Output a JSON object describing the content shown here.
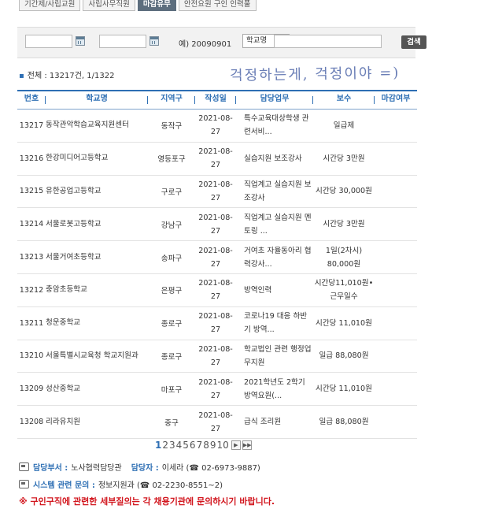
{
  "tabs": [
    "기간제/사립교원",
    "사립사무직원",
    "마감유무",
    "안전요원 구인 인력풀"
  ],
  "search": {
    "example": "예) 20090901",
    "select_value": "학교명",
    "button": "검색",
    "tilde": "~"
  },
  "summary": {
    "text": "전체 : 13217건, 1/1322"
  },
  "handwriting": "걱정하는게, 걱정이야 =)",
  "table": {
    "headers": [
      "번호",
      "학교명",
      "지역구",
      "작성일",
      "담당업무",
      "보수",
      "마감여부"
    ],
    "rows": [
      {
        "no": "13217",
        "school": "동작관악학습교육지원센터",
        "region": "동작구",
        "date_a": "2021-08-",
        "date_b": "27",
        "duty": "특수교육대상학생 관련서비...",
        "pay": "일급제",
        "closed": ""
      },
      {
        "no": "13216",
        "school": "한강미디어고등학교",
        "region": "영등포구",
        "date_a": "2021-08-",
        "date_b": "27",
        "duty": "실습지원 보조강사",
        "pay": "시간당 3만원",
        "closed": ""
      },
      {
        "no": "13215",
        "school": "유한공업고등학교",
        "region": "구로구",
        "date_a": "2021-08-",
        "date_b": "27",
        "duty": "직업계고 실습지원 보조강사",
        "pay": "시간당 30,000원",
        "closed": ""
      },
      {
        "no": "13214",
        "school": "서울로봇고등학교",
        "region": "강남구",
        "date_a": "2021-08-",
        "date_b": "27",
        "duty": "직업계고 실습지원 멘토링 ...",
        "pay": "시간당 3만원",
        "closed": ""
      },
      {
        "no": "13213",
        "school": "서울거여초등학교",
        "region": "송파구",
        "date_a": "2021-08-",
        "date_b": "27",
        "duty": "거여초 자율동아리 협력강사...",
        "pay": "1일(2차시) 80,000원",
        "closed": ""
      },
      {
        "no": "13212",
        "school": "충암초등학교",
        "region": "은평구",
        "date_a": "2021-08-",
        "date_b": "27",
        "duty": "방역인력",
        "pay": "시간당11,010원•근무일수",
        "closed": ""
      },
      {
        "no": "13211",
        "school": "청운중학교",
        "region": "종로구",
        "date_a": "2021-08-",
        "date_b": "27",
        "duty": "코로나19 대응 하반기 방역...",
        "pay": "시간당 11,010원",
        "closed": ""
      },
      {
        "no": "13210",
        "school": "서울특별시교육청 학교지원과",
        "region": "종로구",
        "date_a": "2021-08-",
        "date_b": "27",
        "duty": "학교법인 관련 행정업무지원",
        "pay": "일급 88,080원",
        "closed": ""
      },
      {
        "no": "13209",
        "school": "성산중학교",
        "region": "마포구",
        "date_a": "2021-08-",
        "date_b": "27",
        "duty": "2021학년도 2학기 방역요원(...",
        "pay": "시간당 11,010원",
        "closed": ""
      },
      {
        "no": "13208",
        "school": "리라유치원",
        "region": "중구",
        "date_a": "2021-08-",
        "date_b": "27",
        "duty": "급식 조리원",
        "pay": "일급 88,080원",
        "closed": ""
      }
    ]
  },
  "pagination": {
    "pages": [
      "1",
      "2",
      "3",
      "4",
      "5",
      "6",
      "7",
      "8",
      "9",
      "10"
    ],
    "current": "1",
    "next": "▶",
    "last": "▶▶"
  },
  "contacts": {
    "dept_label": "담당부서 :",
    "dept_value": "노사협력담당관",
    "person_label": "담당자 :",
    "person_value": "이세라 (☎ 02-6973-9887)",
    "system_label": "시스템 관련 문의 :",
    "system_value": "정보지원과 (☎ 02-2230-8551~2)"
  },
  "notice": "※ 구인구직에 관련한 세부질의는 각 채용기관에 문의하시기 바랍니다."
}
